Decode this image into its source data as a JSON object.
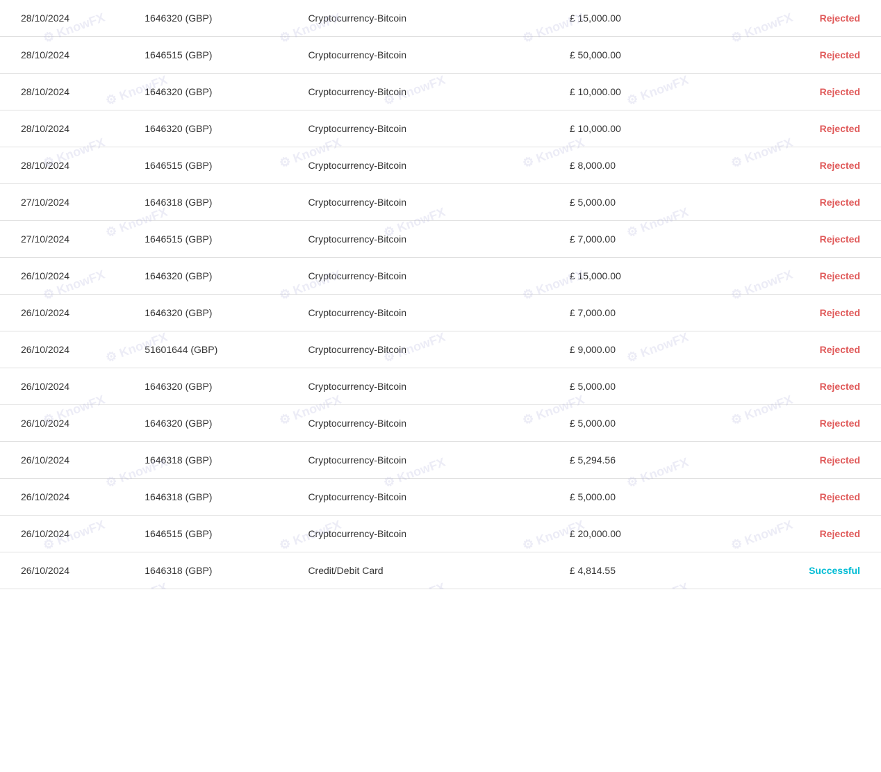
{
  "table": {
    "rows": [
      {
        "date": "28/10/2024",
        "account": "1646320 (GBP)",
        "method": "Cryptocurrency-Bitcoin",
        "amount": "£  15,000.00",
        "status": "Rejected",
        "status_type": "rejected"
      },
      {
        "date": "28/10/2024",
        "account": "1646515 (GBP)",
        "method": "Cryptocurrency-Bitcoin",
        "amount": "£  50,000.00",
        "status": "Rejected",
        "status_type": "rejected"
      },
      {
        "date": "28/10/2024",
        "account": "1646320 (GBP)",
        "method": "Cryptocurrency-Bitcoin",
        "amount": "£  10,000.00",
        "status": "Rejected",
        "status_type": "rejected"
      },
      {
        "date": "28/10/2024",
        "account": "1646320 (GBP)",
        "method": "Cryptocurrency-Bitcoin",
        "amount": "£  10,000.00",
        "status": "Rejected",
        "status_type": "rejected"
      },
      {
        "date": "28/10/2024",
        "account": "1646515 (GBP)",
        "method": "Cryptocurrency-Bitcoin",
        "amount": "£  8,000.00",
        "status": "Rejected",
        "status_type": "rejected"
      },
      {
        "date": "27/10/2024",
        "account": "1646318 (GBP)",
        "method": "Cryptocurrency-Bitcoin",
        "amount": "£  5,000.00",
        "status": "Rejected",
        "status_type": "rejected"
      },
      {
        "date": "27/10/2024",
        "account": "1646515 (GBP)",
        "method": "Cryptocurrency-Bitcoin",
        "amount": "£  7,000.00",
        "status": "Rejected",
        "status_type": "rejected"
      },
      {
        "date": "26/10/2024",
        "account": "1646320 (GBP)",
        "method": "Cryptocurrency-Bitcoin",
        "amount": "£  15,000.00",
        "status": "Rejected",
        "status_type": "rejected"
      },
      {
        "date": "26/10/2024",
        "account": "1646320 (GBP)",
        "method": "Cryptocurrency-Bitcoin",
        "amount": "£  7,000.00",
        "status": "Rejected",
        "status_type": "rejected"
      },
      {
        "date": "26/10/2024",
        "account": "51601644 (GBP)",
        "method": "Cryptocurrency-Bitcoin",
        "amount": "£  9,000.00",
        "status": "Rejected",
        "status_type": "rejected"
      },
      {
        "date": "26/10/2024",
        "account": "1646320 (GBP)",
        "method": "Cryptocurrency-Bitcoin",
        "amount": "£  5,000.00",
        "status": "Rejected",
        "status_type": "rejected"
      },
      {
        "date": "26/10/2024",
        "account": "1646320 (GBP)",
        "method": "Cryptocurrency-Bitcoin",
        "amount": "£  5,000.00",
        "status": "Rejected",
        "status_type": "rejected"
      },
      {
        "date": "26/10/2024",
        "account": "1646318 (GBP)",
        "method": "Cryptocurrency-Bitcoin",
        "amount": "£  5,294.56",
        "status": "Rejected",
        "status_type": "rejected"
      },
      {
        "date": "26/10/2024",
        "account": "1646318 (GBP)",
        "method": "Cryptocurrency-Bitcoin",
        "amount": "£  5,000.00",
        "status": "Rejected",
        "status_type": "rejected"
      },
      {
        "date": "26/10/2024",
        "account": "1646515 (GBP)",
        "method": "Cryptocurrency-Bitcoin",
        "amount": "£  20,000.00",
        "status": "Rejected",
        "status_type": "rejected"
      },
      {
        "date": "26/10/2024",
        "account": "1646318 (GBP)",
        "method": "Credit/Debit Card",
        "amount": "£  4,814.55",
        "status": "Successful",
        "status_type": "successful"
      }
    ]
  },
  "watermark": {
    "text": "KnowFX"
  }
}
